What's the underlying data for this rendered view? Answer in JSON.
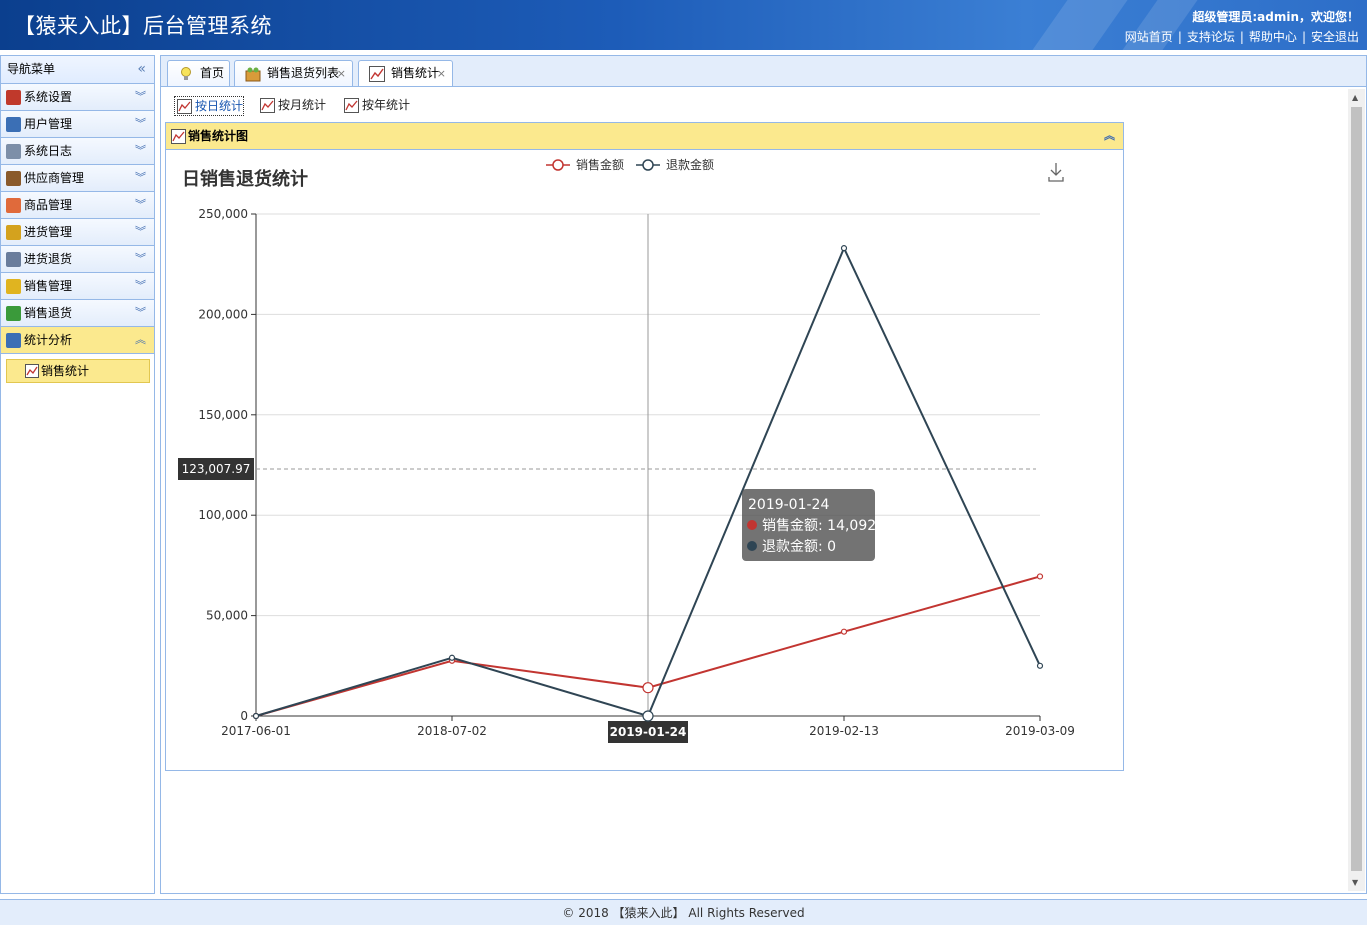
{
  "header": {
    "title": "【猿来入此】后台管理系统",
    "welcome": "超级管理员:admin，欢迎您！",
    "links": [
      "网站首页",
      "支持论坛",
      "帮助中心",
      "安全退出"
    ]
  },
  "sidebar": {
    "title": "导航菜单",
    "groups": [
      {
        "label": "系统设置",
        "icon": "tools-icon",
        "color": "#c0392b"
      },
      {
        "label": "用户管理",
        "icon": "users-icon",
        "color": "#3b6fb5"
      },
      {
        "label": "系统日志",
        "icon": "log-icon",
        "color": "#7d8fa8"
      },
      {
        "label": "供应商管理",
        "icon": "supplier-icon",
        "color": "#8a5a2b"
      },
      {
        "label": "商品管理",
        "icon": "goods-icon",
        "color": "#e06a3b"
      },
      {
        "label": "进货管理",
        "icon": "purchase-icon",
        "color": "#d4a21e"
      },
      {
        "label": "进货退货",
        "icon": "purchase-return-icon",
        "color": "#6a7d9c"
      },
      {
        "label": "销售管理",
        "icon": "sales-icon",
        "color": "#e0b420"
      },
      {
        "label": "销售退货",
        "icon": "sales-return-icon",
        "color": "#3a9a3a"
      },
      {
        "label": "统计分析",
        "icon": "bar-chart-icon",
        "color": "#3b6fb5"
      }
    ],
    "sub_item": "销售统计"
  },
  "tabs": [
    {
      "label": "首页",
      "icon": "bulb-icon",
      "closable": false
    },
    {
      "label": "销售退货列表",
      "icon": "sales-return-list-icon",
      "closable": true
    },
    {
      "label": "销售统计",
      "icon": "line-chart-icon",
      "closable": true
    }
  ],
  "toolbar": [
    "按日统计",
    "按月统计",
    "按年统计"
  ],
  "panel": {
    "title": "销售统计图"
  },
  "footer": "© 2018 【猿来入此】 All Rights Reserved",
  "tooltip": {
    "title": "2019-01-24",
    "rows": [
      "销售金额: 14,092",
      "退款金额: 0"
    ]
  },
  "crosshair": {
    "y_label": "123,007.97",
    "x_label": "2019-01-24"
  },
  "chart_data": {
    "type": "line",
    "title": "日销售退货统计",
    "categories": [
      "2017-06-01",
      "2018-07-02",
      "2019-01-24",
      "2019-02-13",
      "2019-03-09"
    ],
    "series": [
      {
        "name": "销售金额",
        "color": "#c23531",
        "values": [
          0,
          27500,
          14092,
          42000,
          69500
        ]
      },
      {
        "name": "退款金额",
        "color": "#2f4554",
        "values": [
          0,
          29000,
          0,
          233000,
          25000
        ]
      }
    ],
    "ylim": [
      0,
      250000
    ],
    "yticks": [
      0,
      50000,
      100000,
      150000,
      200000,
      250000
    ],
    "ytick_labels": [
      "0",
      "50,000",
      "100,000",
      "150,000",
      "200,000",
      "250,000"
    ],
    "legend": "top-center",
    "grid": true
  }
}
